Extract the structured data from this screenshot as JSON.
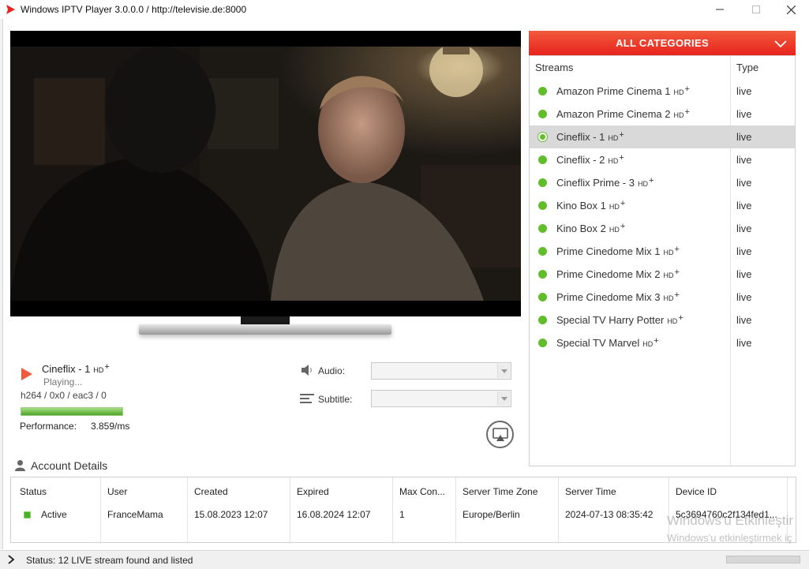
{
  "window": {
    "title": "Windows IPTV Player 3.0.0.0 / http://televisie.de:8000",
    "minimize_icon": "minimize-icon",
    "maximize_icon": "maximize-icon",
    "close_icon": "close-icon"
  },
  "colors": {
    "accent": "#e8231f",
    "live_green": "#62bd2a",
    "selected_row": "#d9d9d9"
  },
  "now_playing": {
    "channel": "Cineflix - 1",
    "hd_label": "HD",
    "plus_label": "+",
    "status": "Playing...",
    "codec": "h264 / 0x0 / eac3 / 0",
    "performance_label": "Performance:",
    "performance_value": "3.859/ms",
    "performance_fraction": 1.0
  },
  "controls": {
    "audio_label": "Audio:",
    "audio_value": "",
    "subtitle_label": "Subtitle:",
    "subtitle_value": "",
    "cast_icon": "cast-icon"
  },
  "categories": {
    "title": "ALL CATEGORIES",
    "chevron_icon": "chevron-down-icon"
  },
  "streams": {
    "col_streams": "Streams",
    "col_type": "Type",
    "items": [
      {
        "name": "Amazon Prime Cinema 1",
        "hd": "HD",
        "plus": "+",
        "type": "live",
        "selected": false
      },
      {
        "name": "Amazon Prime Cinema 2",
        "hd": "HD",
        "plus": "+",
        "type": "live",
        "selected": false
      },
      {
        "name": "Cineflix - 1",
        "hd": "HD",
        "plus": "+",
        "type": "live",
        "selected": true
      },
      {
        "name": "Cineflix - 2",
        "hd": "HD",
        "plus": "+",
        "type": "live",
        "selected": false
      },
      {
        "name": "Cineflix Prime - 3",
        "hd": "HD",
        "plus": "+",
        "type": "live",
        "selected": false
      },
      {
        "name": "Kino Box 1",
        "hd": "HD",
        "plus": "+",
        "type": "live",
        "selected": false
      },
      {
        "name": "Kino Box 2",
        "hd": "HD",
        "plus": "+",
        "type": "live",
        "selected": false
      },
      {
        "name": "Prime Cinedome Mix 1",
        "hd": "HD",
        "plus": "+",
        "type": "live",
        "selected": false
      },
      {
        "name": "Prime Cinedome Mix 2",
        "hd": "HD",
        "plus": "+",
        "type": "live",
        "selected": false
      },
      {
        "name": "Prime Cinedome Mix 3",
        "hd": "HD",
        "plus": "+",
        "type": "live",
        "selected": false
      },
      {
        "name": "Special TV Harry Potter",
        "hd": "HD",
        "plus": "+",
        "type": "live",
        "selected": false
      },
      {
        "name": "Special TV Marvel",
        "hd": "HD",
        "plus": "+",
        "type": "live",
        "selected": false
      }
    ]
  },
  "account": {
    "title": "Account Details",
    "icon": "user-icon",
    "headers": {
      "status": "Status",
      "user": "User",
      "created": "Created",
      "expired": "Expired",
      "max_con": "Max Con...",
      "timezone": "Server Time Zone",
      "server_time": "Server Time",
      "device_id": "Device ID"
    },
    "values": {
      "status": "Active",
      "user": "FranceMama",
      "created": "15.08.2023 12:07",
      "expired": "16.08.2024 12:07",
      "max_con": "1",
      "timezone": "Europe/Berlin",
      "server_time": "2024-07-13 08:35:42",
      "device_id": "5c3694760c2f134fed1..."
    }
  },
  "watermark": {
    "line1": "Windows'u Etkinleştir",
    "line2": "Windows'u etkinleştirmek iç"
  },
  "statusbar": {
    "text": "Status: 12 LIVE stream found and listed",
    "chevron_icon": "chevron-right-icon"
  }
}
